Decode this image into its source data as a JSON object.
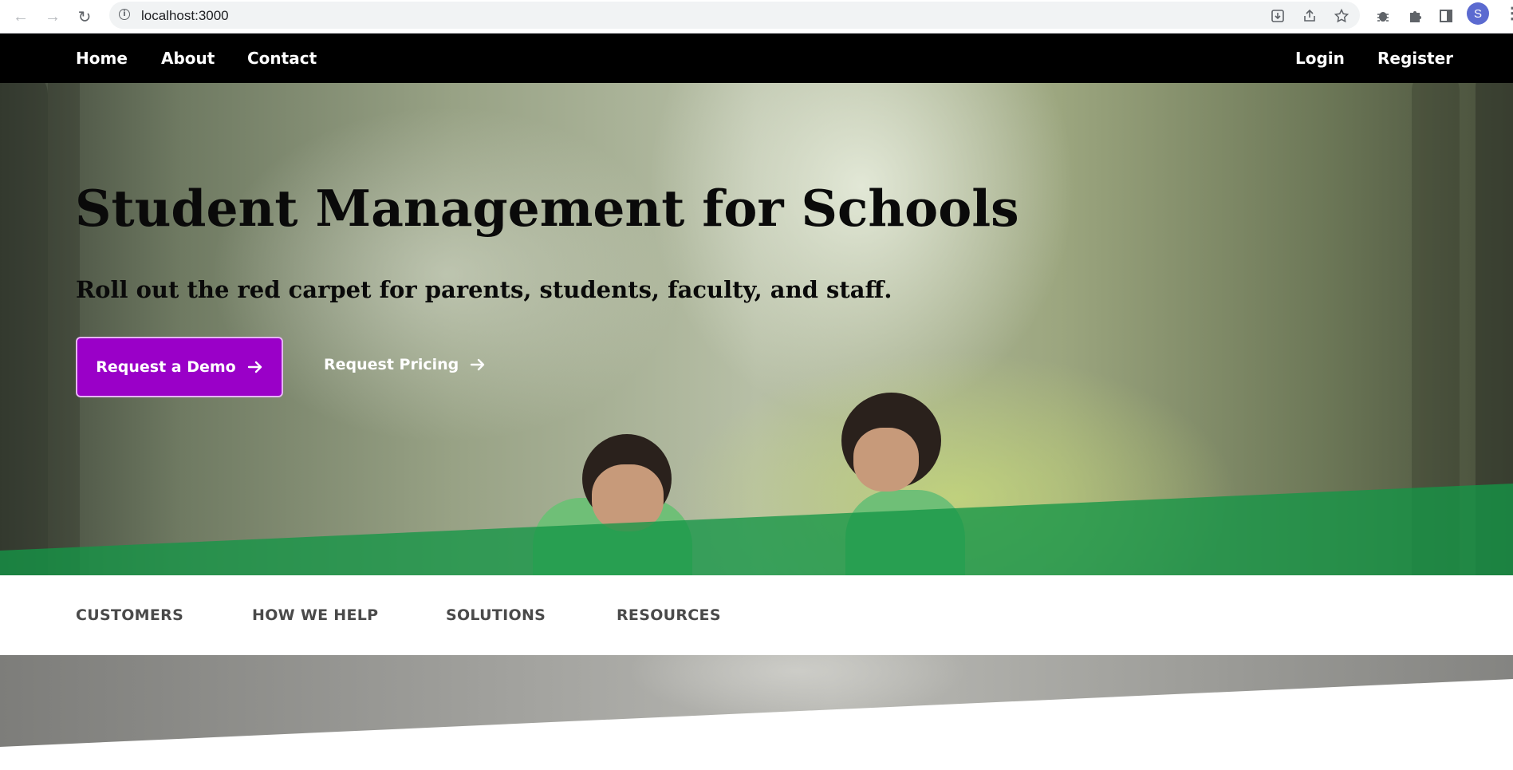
{
  "browser": {
    "url": "localhost:3000",
    "profile_initial": "S"
  },
  "nav": {
    "left": [
      "Home",
      "About",
      "Contact"
    ],
    "right": [
      "Login",
      "Register"
    ]
  },
  "hero": {
    "title": "Student Management for Schools",
    "subtitle": "Roll out the red carpet for parents, students, faculty, and staff.",
    "primary_cta": "Request a Demo",
    "secondary_cta": "Request Pricing",
    "accent_color": "#9a00c8",
    "band_color": "#14a046"
  },
  "subnav": {
    "items": [
      "CUSTOMERS",
      "HOW WE HELP",
      "SOLUTIONS",
      "RESOURCES"
    ]
  }
}
